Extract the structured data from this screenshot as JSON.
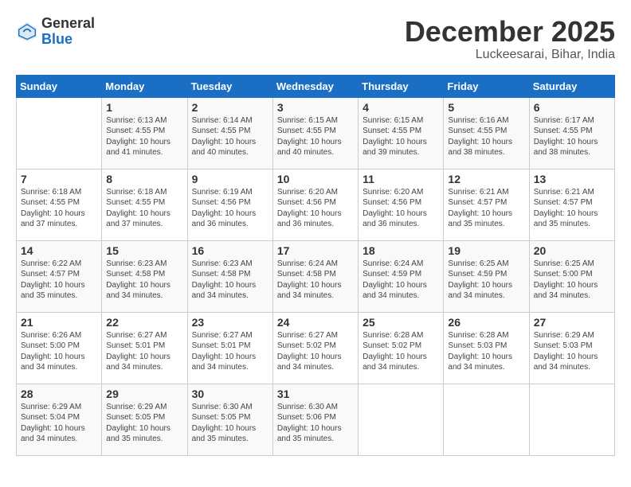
{
  "header": {
    "logo_general": "General",
    "logo_blue": "Blue",
    "month_title": "December 2025",
    "location": "Luckeesarai, Bihar, India"
  },
  "days_of_week": [
    "Sunday",
    "Monday",
    "Tuesday",
    "Wednesday",
    "Thursday",
    "Friday",
    "Saturday"
  ],
  "weeks": [
    [
      {
        "day": "",
        "info": ""
      },
      {
        "day": "1",
        "info": "Sunrise: 6:13 AM\nSunset: 4:55 PM\nDaylight: 10 hours\nand 41 minutes."
      },
      {
        "day": "2",
        "info": "Sunrise: 6:14 AM\nSunset: 4:55 PM\nDaylight: 10 hours\nand 40 minutes."
      },
      {
        "day": "3",
        "info": "Sunrise: 6:15 AM\nSunset: 4:55 PM\nDaylight: 10 hours\nand 40 minutes."
      },
      {
        "day": "4",
        "info": "Sunrise: 6:15 AM\nSunset: 4:55 PM\nDaylight: 10 hours\nand 39 minutes."
      },
      {
        "day": "5",
        "info": "Sunrise: 6:16 AM\nSunset: 4:55 PM\nDaylight: 10 hours\nand 38 minutes."
      },
      {
        "day": "6",
        "info": "Sunrise: 6:17 AM\nSunset: 4:55 PM\nDaylight: 10 hours\nand 38 minutes."
      }
    ],
    [
      {
        "day": "7",
        "info": "Sunrise: 6:18 AM\nSunset: 4:55 PM\nDaylight: 10 hours\nand 37 minutes."
      },
      {
        "day": "8",
        "info": "Sunrise: 6:18 AM\nSunset: 4:55 PM\nDaylight: 10 hours\nand 37 minutes."
      },
      {
        "day": "9",
        "info": "Sunrise: 6:19 AM\nSunset: 4:56 PM\nDaylight: 10 hours\nand 36 minutes."
      },
      {
        "day": "10",
        "info": "Sunrise: 6:20 AM\nSunset: 4:56 PM\nDaylight: 10 hours\nand 36 minutes."
      },
      {
        "day": "11",
        "info": "Sunrise: 6:20 AM\nSunset: 4:56 PM\nDaylight: 10 hours\nand 36 minutes."
      },
      {
        "day": "12",
        "info": "Sunrise: 6:21 AM\nSunset: 4:57 PM\nDaylight: 10 hours\nand 35 minutes."
      },
      {
        "day": "13",
        "info": "Sunrise: 6:21 AM\nSunset: 4:57 PM\nDaylight: 10 hours\nand 35 minutes."
      }
    ],
    [
      {
        "day": "14",
        "info": "Sunrise: 6:22 AM\nSunset: 4:57 PM\nDaylight: 10 hours\nand 35 minutes."
      },
      {
        "day": "15",
        "info": "Sunrise: 6:23 AM\nSunset: 4:58 PM\nDaylight: 10 hours\nand 34 minutes."
      },
      {
        "day": "16",
        "info": "Sunrise: 6:23 AM\nSunset: 4:58 PM\nDaylight: 10 hours\nand 34 minutes."
      },
      {
        "day": "17",
        "info": "Sunrise: 6:24 AM\nSunset: 4:58 PM\nDaylight: 10 hours\nand 34 minutes."
      },
      {
        "day": "18",
        "info": "Sunrise: 6:24 AM\nSunset: 4:59 PM\nDaylight: 10 hours\nand 34 minutes."
      },
      {
        "day": "19",
        "info": "Sunrise: 6:25 AM\nSunset: 4:59 PM\nDaylight: 10 hours\nand 34 minutes."
      },
      {
        "day": "20",
        "info": "Sunrise: 6:25 AM\nSunset: 5:00 PM\nDaylight: 10 hours\nand 34 minutes."
      }
    ],
    [
      {
        "day": "21",
        "info": "Sunrise: 6:26 AM\nSunset: 5:00 PM\nDaylight: 10 hours\nand 34 minutes."
      },
      {
        "day": "22",
        "info": "Sunrise: 6:27 AM\nSunset: 5:01 PM\nDaylight: 10 hours\nand 34 minutes."
      },
      {
        "day": "23",
        "info": "Sunrise: 6:27 AM\nSunset: 5:01 PM\nDaylight: 10 hours\nand 34 minutes."
      },
      {
        "day": "24",
        "info": "Sunrise: 6:27 AM\nSunset: 5:02 PM\nDaylight: 10 hours\nand 34 minutes."
      },
      {
        "day": "25",
        "info": "Sunrise: 6:28 AM\nSunset: 5:02 PM\nDaylight: 10 hours\nand 34 minutes."
      },
      {
        "day": "26",
        "info": "Sunrise: 6:28 AM\nSunset: 5:03 PM\nDaylight: 10 hours\nand 34 minutes."
      },
      {
        "day": "27",
        "info": "Sunrise: 6:29 AM\nSunset: 5:03 PM\nDaylight: 10 hours\nand 34 minutes."
      }
    ],
    [
      {
        "day": "28",
        "info": "Sunrise: 6:29 AM\nSunset: 5:04 PM\nDaylight: 10 hours\nand 34 minutes."
      },
      {
        "day": "29",
        "info": "Sunrise: 6:29 AM\nSunset: 5:05 PM\nDaylight: 10 hours\nand 35 minutes."
      },
      {
        "day": "30",
        "info": "Sunrise: 6:30 AM\nSunset: 5:05 PM\nDaylight: 10 hours\nand 35 minutes."
      },
      {
        "day": "31",
        "info": "Sunrise: 6:30 AM\nSunset: 5:06 PM\nDaylight: 10 hours\nand 35 minutes."
      },
      {
        "day": "",
        "info": ""
      },
      {
        "day": "",
        "info": ""
      },
      {
        "day": "",
        "info": ""
      }
    ]
  ]
}
